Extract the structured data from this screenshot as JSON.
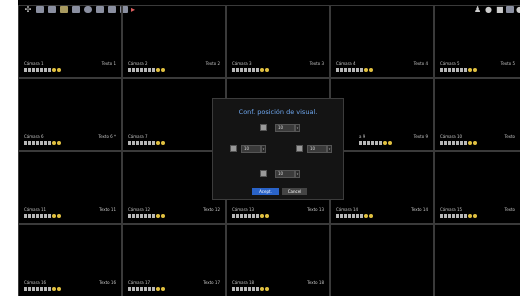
{
  "toolbar": {
    "left_icons": [
      "tools-icon",
      "layout-1-icon",
      "layout-4-icon",
      "layout-9-icon",
      "layout-16-icon",
      "sequence-icon",
      "layout-grid-icon",
      "layout-custom-icon",
      "layout-list-icon",
      "more-icon"
    ],
    "right_icons": [
      "user-icon",
      "record-icon",
      "lock-icon",
      "display-icon",
      "info-icon"
    ]
  },
  "cells": [
    {
      "camera": "Cámara 1",
      "text": "Texto 1"
    },
    {
      "camera": "Cámara 2",
      "text": "Texto 2"
    },
    {
      "camera": "Cámara 3",
      "text": "Texto 3"
    },
    {
      "camera": "Cámara 4",
      "text": "Texto 4"
    },
    {
      "camera": "Cámara 5",
      "text": "Texto 5"
    },
    {
      "camera": "Cámara 6",
      "text": "Texto 6 *"
    },
    {
      "camera": "Cámara 7",
      "text": "Text"
    },
    {
      "camera": "",
      "text": ""
    },
    {
      "camera": "a 9",
      "text": "Texto 9"
    },
    {
      "camera": "Cámara 10",
      "text": "Texto"
    },
    {
      "camera": "Cámara 11",
      "text": "Texto 11"
    },
    {
      "camera": "Cámara 12",
      "text": "Texto 12"
    },
    {
      "camera": "Cámara 13",
      "text": "Texto 13"
    },
    {
      "camera": "Cámara 14",
      "text": "Texto 14"
    },
    {
      "camera": "Cámara 15",
      "text": "Texto"
    },
    {
      "camera": "Cámara 16",
      "text": "Texto 16"
    },
    {
      "camera": "Cámara 17",
      "text": "Texto 17"
    },
    {
      "camera": "Cámara 18",
      "text": "Texto 18"
    },
    {
      "camera": "",
      "text": ""
    },
    {
      "camera": "",
      "text": ""
    }
  ],
  "dialog": {
    "title": "Conf. posición de visual.",
    "top_value": "10",
    "left_value": "10",
    "right_value": "10",
    "bottom_value": "10",
    "ok_label": "Acept.",
    "cancel_label": "Cancel"
  },
  "colors": {
    "screen_bg": "#000000",
    "title_accent": "#6fa8f0",
    "ok_button": "#2a63c8"
  }
}
